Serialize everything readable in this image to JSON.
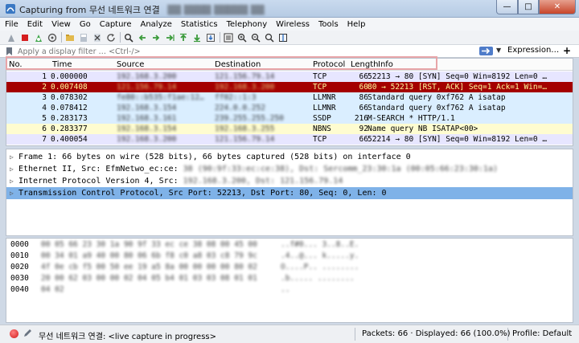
{
  "window": {
    "title": "Capturing from 무선 네트워크 연결",
    "title_blurred_suffix": "▒▒ ▒▒▒▒ ▒▒▒▒▒ ▒▒",
    "minimize_label": "—",
    "maximize_label": "□",
    "close_label": "✕"
  },
  "menu": [
    "File",
    "Edit",
    "View",
    "Go",
    "Capture",
    "Analyze",
    "Statistics",
    "Telephony",
    "Wireless",
    "Tools",
    "Help"
  ],
  "toolbar_icons": [
    "shark-fin-icon",
    "stop-icon",
    "restart-icon",
    "capture-options-icon",
    "open-icon",
    "save-icon",
    "close-file-icon",
    "reload-icon",
    "find-icon",
    "back-icon",
    "forward-icon",
    "go-to-icon",
    "first-icon",
    "last-icon",
    "autoscroll-icon",
    "colorize-icon",
    "zoom-in-icon",
    "zoom-out-icon",
    "normal-size-icon",
    "resize-columns-icon"
  ],
  "filter": {
    "placeholder": "Apply a display filter … <Ctrl-/>",
    "expression_label": "Expression…",
    "add_label": "+"
  },
  "packet_list": {
    "columns": [
      "No.",
      "Time",
      "Source",
      "Destination",
      "Protocol",
      "Length",
      "Info"
    ],
    "rows": [
      {
        "no": "1",
        "time": "0.000000",
        "source": "192.168.3.200",
        "destination": "121.156.79.14",
        "protocol": "TCP",
        "length": "66",
        "info": "52213 → 80 [SYN] Seq=0 Win=8192 Len=0 …",
        "color": "#e7e6ff",
        "fg": "#000000"
      },
      {
        "no": "2",
        "time": "0.007408",
        "source": "121.156.79.14",
        "destination": "192.168.3.200",
        "protocol": "TCP",
        "length": "60",
        "info": "80 → 52213 [RST, ACK] Seq=1 Ack=1 Win=…",
        "color": "#a40000",
        "fg": "#fffc9c"
      },
      {
        "no": "3",
        "time": "0.078302",
        "source": "fe80::b535:f1ae:12…",
        "destination": "ff02::1:3",
        "protocol": "LLMNR",
        "length": "86",
        "info": "Standard query 0xf762 A isatap",
        "color": "#daeeff",
        "fg": "#000000"
      },
      {
        "no": "4",
        "time": "0.078412",
        "source": "192.168.3.154",
        "destination": "224.0.0.252",
        "protocol": "LLMNR",
        "length": "66",
        "info": "Standard query 0xf762 A isatap",
        "color": "#daeeff",
        "fg": "#000000"
      },
      {
        "no": "5",
        "time": "0.283173",
        "source": "192.168.3.161",
        "destination": "239.255.255.250",
        "protocol": "SSDP",
        "length": "216",
        "info": "M-SEARCH * HTTP/1.1",
        "color": "#daeeff",
        "fg": "#000000"
      },
      {
        "no": "6",
        "time": "0.283377",
        "source": "192.168.3.154",
        "destination": "192.168.3.255",
        "protocol": "NBNS",
        "length": "92",
        "info": "Name query NB ISATAP<00>",
        "color": "#fefcd0",
        "fg": "#000000"
      },
      {
        "no": "7",
        "time": "0.400054",
        "source": "192.168.3.200",
        "destination": "121.156.79.14",
        "protocol": "TCP",
        "length": "66",
        "info": "52214 → 80 [SYN] Seq=0 Win=8192 Len=0 …",
        "color": "#e7e6ff",
        "fg": "#000000"
      }
    ]
  },
  "details": [
    {
      "text": "Frame 1: 66 bytes on wire (528 bits), 66 bytes captured (528 bits) on interface 0",
      "blurred": "",
      "selected": false
    },
    {
      "text": "Ethernet II, Src: EfmNetwo_ec:ce:",
      "blurred": "38 (90:9f:33:ec:ce:38), Dst: Sercomm_23:30:1a (00:05:66:23:30:1a)",
      "selected": false
    },
    {
      "text": "Internet Protocol Version 4, Src:",
      "blurred": "192.168.3.200, Dst: 121.156.79.14",
      "selected": false
    },
    {
      "text": "Transmission Control Protocol, Src Port: 52213, Dst Port: 80, Seq: 0, Len: 0",
      "blurred": "",
      "selected": true
    }
  ],
  "bytes": [
    {
      "offset": "0000",
      "hex": "00 05 66 23 30 1a 90 9f  33 ec ce 38 08 00 45 00",
      "ascii": "..f#0... 3..8..E."
    },
    {
      "offset": "0010",
      "hex": "00 34 01 a9 40 00 80 06  6b f8 c0 a8 03 c8 79 9c",
      "ascii": ".4..@... k.....y."
    },
    {
      "offset": "0020",
      "hex": "4f 0e cb f5 00 50 ee 19  a5 8a 00 00 00 00 80 02",
      "ascii": "O....P.. ........"
    },
    {
      "offset": "0030",
      "hex": "20 00 62 03 00 00 02 04  05 b4 01 03 03 08 01 01",
      "ascii": " .b..... ........"
    },
    {
      "offset": "0040",
      "hex": "04 02",
      "ascii": ".."
    }
  ],
  "status": {
    "capture_text": "무선 네트워크 연결: <live capture in progress>",
    "packets_text": "Packets: 66 · Displayed: 66 (100.0%)",
    "profile_text": "Profile: Default"
  },
  "colors": {
    "selected_row": "#a40000",
    "selected_detail": "#7fb2e8",
    "filter_highlight": "#e8a5a8"
  }
}
